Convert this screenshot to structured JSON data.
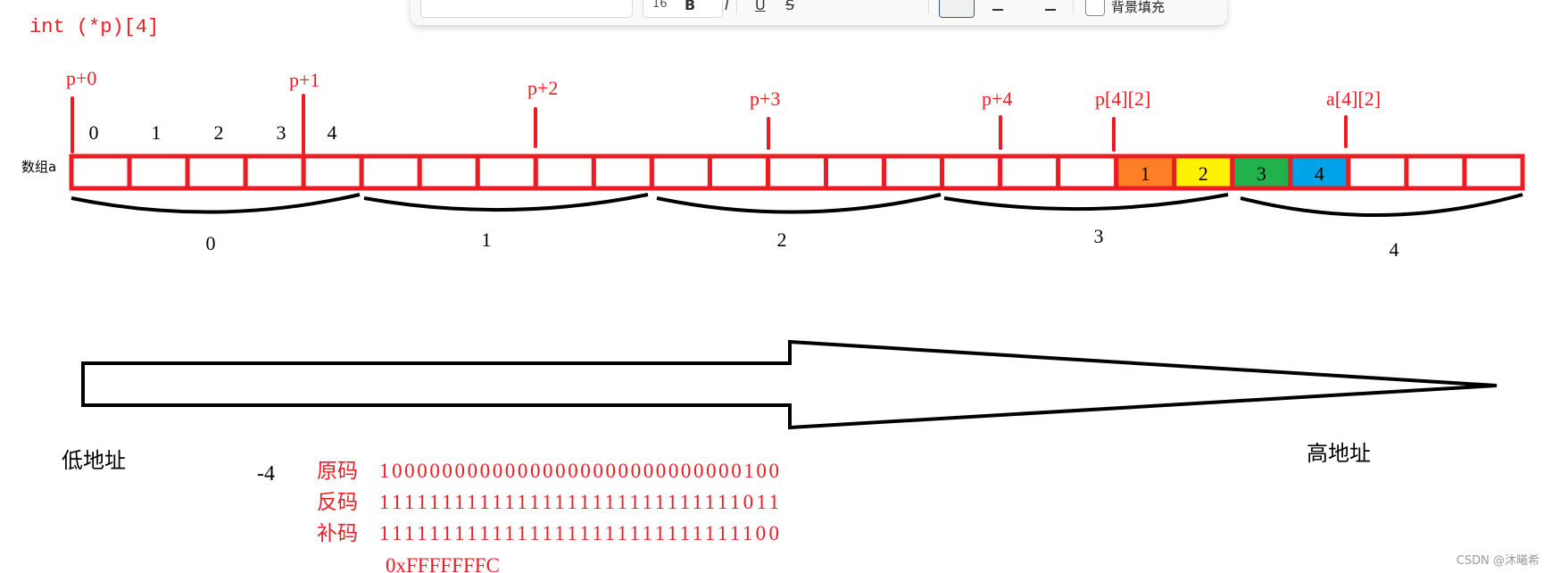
{
  "declaration": "int (*p)[4]",
  "array_label": "数组a",
  "element_indices": [
    "0",
    "1",
    "2",
    "3",
    "4"
  ],
  "pointer_labels": [
    "p+0",
    "p+1",
    "p+2",
    "p+3",
    "p+4",
    "p[4][2]",
    "a[4][2]"
  ],
  "cell_count": 25,
  "highlighted_cells": [
    {
      "index": 18,
      "label": "1",
      "color": "#ff7f27"
    },
    {
      "index": 19,
      "label": "2",
      "color": "#fff200"
    },
    {
      "index": 20,
      "label": "3",
      "color": "#22b14c"
    },
    {
      "index": 21,
      "label": "4",
      "color": "#00a2e8"
    }
  ],
  "group_labels": [
    "0",
    "1",
    "2",
    "3",
    "4"
  ],
  "low_address": "低地址",
  "high_address": "高地址",
  "number": "-4",
  "encodings": [
    {
      "name": "原码",
      "bits": "10000000000000000000000000000100"
    },
    {
      "name": "反码",
      "bits": "11111111111111111111111111111011"
    },
    {
      "name": "补码",
      "bits": "11111111111111111111111111111100"
    }
  ],
  "hex": "0xFFFFFFFC",
  "toolbar": {
    "font_size": "16",
    "bold": "B",
    "italic": "I",
    "underline": "U",
    "strike": "S",
    "background_fill": "背景填充"
  },
  "colors": {
    "accent_red": "#ed1c24"
  },
  "watermark": "CSDN @沐曦希"
}
